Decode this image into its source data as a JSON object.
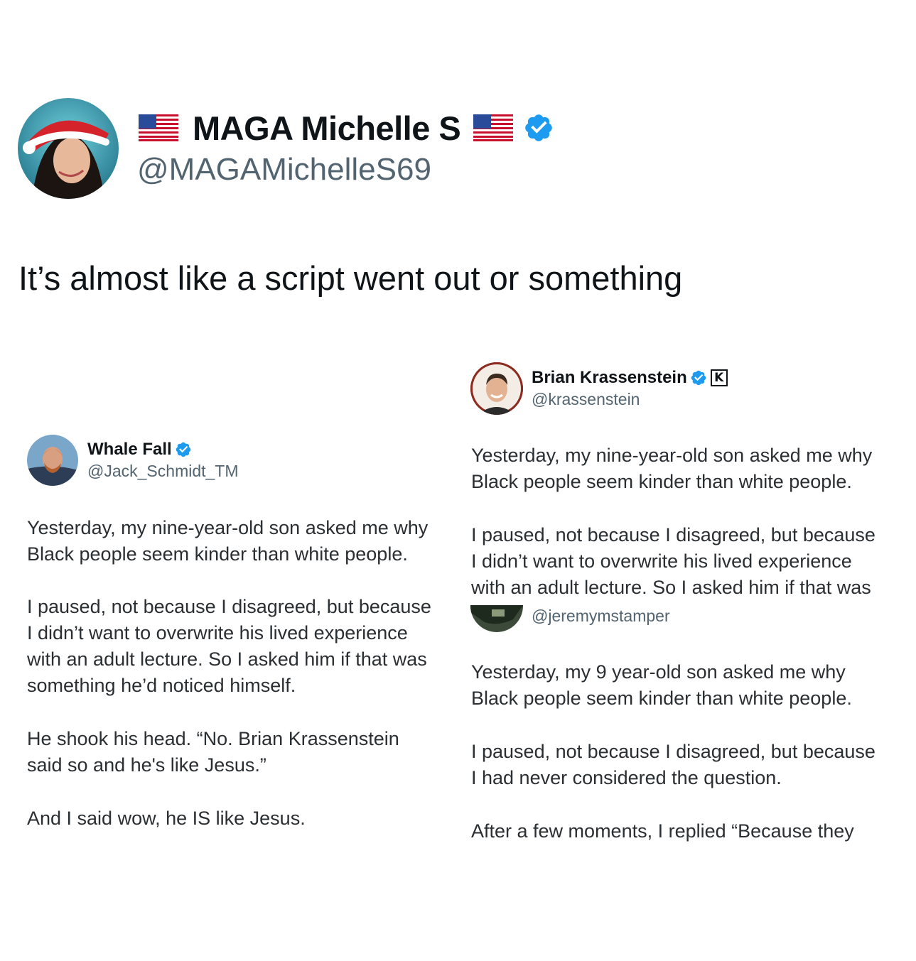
{
  "main_tweet": {
    "author_name": "MAGA Michelle S",
    "handle": "@MAGAMichelleS69",
    "text": "It’s almost like a script went out or something",
    "flag_icon": "us-flag-icon",
    "verified_icon": "verified-badge-icon",
    "verified_color": "#1d9bf0"
  },
  "left_card": {
    "author_name": "Whale Fall",
    "handle": "@Jack_Schmidt_TM",
    "paragraphs": [
      "Yesterday, my nine-year-old son asked me why\nBlack people seem kinder than white people.",
      "I paused, not because I disagreed, but because\nI didn’t want to overwrite his lived experience\nwith an adult lecture. So I asked him if that was\nsomething he’d noticed himself.",
      "He shook his head. “No. Brian Krassenstein\nsaid so and he's like Jesus.”",
      "And I said wow, he IS like Jesus."
    ]
  },
  "right_card": {
    "author_name": "Brian Krassenstein",
    "handle": "@krassenstein",
    "paragraphs": [
      "Yesterday, my nine-year-old son asked me why\nBlack people seem kinder than white people.",
      "I paused, not because I disagreed, but because\nI didn’t want to overwrite his lived experience\nwith an adult lecture. So I asked him if that was"
    ],
    "logo_letter": "K"
  },
  "nested_card": {
    "handle": "@jeremymstamper",
    "paragraphs": [
      "Yesterday, my 9 year-old son asked me why\nBlack people seem kinder than white people.",
      "I paused, not because I disagreed, but because\nI had never considered the question.",
      "After a few moments, I replied “Because they"
    ]
  }
}
